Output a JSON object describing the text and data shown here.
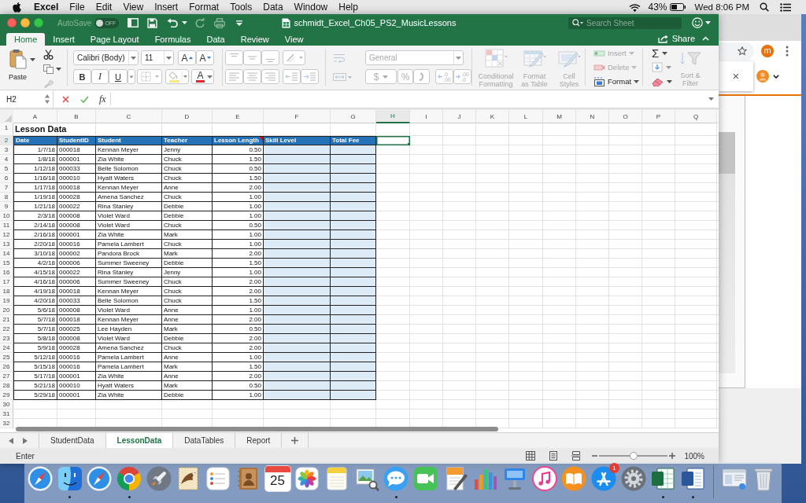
{
  "menu_bar": {
    "app_name": "Excel",
    "menus": [
      "File",
      "Edit",
      "View",
      "Insert",
      "Format",
      "Tools",
      "Data",
      "Window",
      "Help"
    ],
    "battery": "43%",
    "clock": "Wed 8:06 PM"
  },
  "background_window": {
    "avatar_letter": "m",
    "close": "×"
  },
  "excel_window": {
    "autosave_label": "AutoSave",
    "autosave_toggle": {
      "label": "OFF",
      "on": false
    },
    "title": "schmidt_Excel_Ch05_PS2_MusicLessons",
    "search": {
      "placeholder": "Search Sheet"
    },
    "share": "Share"
  },
  "ribbon_tabs": [
    {
      "label": "Home",
      "selected": true
    },
    {
      "label": "Insert",
      "selected": false
    },
    {
      "label": "Page Layout",
      "selected": false
    },
    {
      "label": "Formulas",
      "selected": false
    },
    {
      "label": "Data",
      "selected": false
    },
    {
      "label": "Review",
      "selected": false
    },
    {
      "label": "View",
      "selected": false
    }
  ],
  "ribbon": {
    "paste": "Paste",
    "font_name": "Calibri (Body)",
    "font_size": "11",
    "grow_font": "A",
    "shrink_font": "A",
    "bold": "B",
    "italic": "I",
    "underline": "U",
    "font_color": "A",
    "number_format": {
      "value": "General",
      "disabled": true
    },
    "currency": {
      "label": "$",
      "disabled": true
    },
    "percent": {
      "label": "%",
      "disabled": true
    },
    "decimals": [
      {
        "top": ".0",
        "bottom": ".00",
        "disabled": true
      },
      {
        "top": ".00",
        "bottom": ".0",
        "disabled": true
      }
    ],
    "styles": [
      {
        "label": "Conditional Formatting",
        "disabled": true
      },
      {
        "label": "Format as Table",
        "disabled": true
      },
      {
        "label": "Cell Styles",
        "disabled": true
      }
    ],
    "cells": [
      {
        "label": "Insert",
        "disabled": true
      },
      {
        "label": "Delete",
        "disabled": true
      },
      {
        "label": "Format",
        "disabled": false
      }
    ],
    "autosum": "Σ",
    "sort_filter": {
      "label": "Sort & Filter",
      "disabled": true
    }
  },
  "formula_bar": {
    "name_box": "H2",
    "function_label": "fx"
  },
  "sheet": {
    "columns": [
      {
        "label": "A",
        "selected": false
      },
      {
        "label": "B",
        "selected": false
      },
      {
        "label": "C",
        "selected": false
      },
      {
        "label": "D",
        "selected": false
      },
      {
        "label": "E",
        "selected": false
      },
      {
        "label": "F",
        "selected": false
      },
      {
        "label": "G",
        "selected": false
      },
      {
        "label": "H",
        "selected": true
      },
      {
        "label": "I",
        "selected": false
      },
      {
        "label": "J",
        "selected": false
      },
      {
        "label": "K",
        "selected": false
      },
      {
        "label": "L",
        "selected": false
      },
      {
        "label": "M",
        "selected": false
      },
      {
        "label": "N",
        "selected": false
      },
      {
        "label": "O",
        "selected": false
      },
      {
        "label": "P",
        "selected": false
      },
      {
        "label": "Q",
        "selected": false
      }
    ],
    "row_headers": [
      {
        "label": "1",
        "active": false
      },
      {
        "label": "2",
        "active": true
      },
      {
        "label": "3",
        "active": false
      },
      {
        "label": "4",
        "active": false
      },
      {
        "label": "5",
        "active": false
      },
      {
        "label": "6",
        "active": false
      },
      {
        "label": "7",
        "active": false
      },
      {
        "label": "8",
        "active": false
      },
      {
        "label": "9",
        "active": false
      },
      {
        "label": "10",
        "active": false
      },
      {
        "label": "11",
        "active": false
      },
      {
        "label": "12",
        "active": false
      },
      {
        "label": "13",
        "active": false
      },
      {
        "label": "14",
        "active": false
      },
      {
        "label": "15",
        "active": false
      },
      {
        "label": "16",
        "active": false
      },
      {
        "label": "17",
        "active": false
      },
      {
        "label": "18",
        "active": false
      },
      {
        "label": "19",
        "active": false
      },
      {
        "label": "20",
        "active": false
      },
      {
        "label": "21",
        "active": false
      },
      {
        "label": "22",
        "active": false
      },
      {
        "label": "23",
        "active": false
      },
      {
        "label": "24",
        "active": false
      },
      {
        "label": "25",
        "active": false
      },
      {
        "label": "26",
        "active": false
      },
      {
        "label": "27",
        "active": false
      },
      {
        "label": "28",
        "active": false
      },
      {
        "label": "29",
        "active": false
      },
      {
        "label": "30",
        "active": false
      },
      {
        "label": "31",
        "active": false
      },
      {
        "label": "32",
        "active": false
      }
    ],
    "title": "Lesson Data",
    "headers": [
      {
        "label": "Date",
        "comment": false
      },
      {
        "label": "StudentID",
        "comment": false
      },
      {
        "label": "Student",
        "comment": false
      },
      {
        "label": "Teacher",
        "comment": false
      },
      {
        "label": "Lesson Length",
        "comment": true
      },
      {
        "label": "Skill Level",
        "comment": false
      },
      {
        "label": "Total Fee",
        "comment": false
      }
    ],
    "rows": [
      [
        "1/7/18",
        "000018",
        "Kennan Meyer",
        "Jenny",
        "0.50"
      ],
      [
        "1/8/18",
        "000001",
        "Zia White",
        "Chuck",
        "1.50"
      ],
      [
        "1/12/18",
        "000033",
        "Belle Solomon",
        "Chuck",
        "0.50"
      ],
      [
        "1/16/18",
        "000010",
        "Hyatt Waters",
        "Chuck",
        "1.50"
      ],
      [
        "1/17/18",
        "000018",
        "Kennan Meyer",
        "Anne",
        "2.00"
      ],
      [
        "1/19/18",
        "000028",
        "Amena Sanchez",
        "Chuck",
        "1.00"
      ],
      [
        "1/21/18",
        "000022",
        "Rina Stanley",
        "Debbie",
        "1.00"
      ],
      [
        "2/3/18",
        "000008",
        "Violet Ward",
        "Debbie",
        "1.00"
      ],
      [
        "2/14/18",
        "000008",
        "Violet Ward",
        "Chuck",
        "0.50"
      ],
      [
        "2/16/18",
        "000001",
        "Zia White",
        "Mark",
        "1.00"
      ],
      [
        "2/20/18",
        "000016",
        "Pamela Lambert",
        "Chuck",
        "1.00"
      ],
      [
        "3/10/18",
        "000002",
        "Pandora Brock",
        "Mark",
        "2.00"
      ],
      [
        "4/2/18",
        "000006",
        "Summer Sweeney",
        "Debbie",
        "1.50"
      ],
      [
        "4/15/18",
        "000022",
        "Rina Stanley",
        "Jenny",
        "1.00"
      ],
      [
        "4/16/18",
        "000006",
        "Summer Sweeney",
        "Chuck",
        "2.00"
      ],
      [
        "4/19/18",
        "000018",
        "Kennan Meyer",
        "Chuck",
        "2.00"
      ],
      [
        "4/20/18",
        "000033",
        "Belle Solomon",
        "Chuck",
        "1.50"
      ],
      [
        "5/6/18",
        "000008",
        "Violet Ward",
        "Anne",
        "1.00"
      ],
      [
        "5/7/18",
        "000018",
        "Kennan Meyer",
        "Anne",
        "2.00"
      ],
      [
        "5/7/18",
        "000025",
        "Lee Hayden",
        "Mark",
        "0.50"
      ],
      [
        "5/8/18",
        "000008",
        "Violet Ward",
        "Debbie",
        "2.00"
      ],
      [
        "5/9/18",
        "000028",
        "Amena Sanchez",
        "Chuck",
        "2.00"
      ],
      [
        "5/12/18",
        "000016",
        "Pamela Lambert",
        "Anne",
        "1.00"
      ],
      [
        "5/15/18",
        "000016",
        "Pamela Lambert",
        "Mark",
        "1.50"
      ],
      [
        "5/17/18",
        "000001",
        "Zia White",
        "Anne",
        "2.00"
      ],
      [
        "5/21/18",
        "000010",
        "Hyatt Waters",
        "Mark",
        "0.50"
      ],
      [
        "5/29/18",
        "000001",
        "Zia White",
        "Debbie",
        "1.00"
      ]
    ]
  },
  "sheet_tabs": [
    {
      "label": "StudentData",
      "selected": false
    },
    {
      "label": "LessonData",
      "selected": true
    },
    {
      "label": "DataTables",
      "selected": false
    },
    {
      "label": "Report",
      "selected": false
    }
  ],
  "status_bar": {
    "mode": "Enter",
    "zoom": {
      "level": 0.5,
      "label": "100%"
    }
  },
  "dock": {
    "apps": [
      {
        "kind": "compass",
        "running": false
      },
      {
        "kind": "face",
        "running": true
      },
      {
        "kind": "compass",
        "running": false
      },
      {
        "kind": "wheel",
        "running": true
      },
      {
        "kind": "rocket",
        "running": false
      },
      {
        "kind": "stamp",
        "running": false
      },
      {
        "kind": "checklist",
        "running": false
      },
      {
        "kind": "contacts",
        "running": false
      },
      {
        "kind": "calendar",
        "running": false,
        "date": "25"
      },
      {
        "kind": "flower",
        "running": false
      },
      {
        "kind": "notepad",
        "running": false
      },
      {
        "kind": "viewer",
        "running": false
      },
      {
        "kind": "bubble",
        "running": true
      },
      {
        "kind": "camera",
        "running": false
      },
      {
        "kind": "pages",
        "running": false
      },
      {
        "kind": "chart",
        "running": false
      },
      {
        "kind": "podium",
        "running": false
      },
      {
        "kind": "music",
        "running": false
      },
      {
        "kind": "book",
        "running": false
      },
      {
        "kind": "store",
        "running": false,
        "badge": "1"
      },
      {
        "kind": "gear",
        "running": false
      },
      {
        "kind": "spreadsheet",
        "running": true
      },
      {
        "kind": "document",
        "running": true
      }
    ],
    "others": [
      {
        "kind": "window",
        "running": false
      },
      {
        "kind": "trash",
        "running": false
      }
    ]
  }
}
